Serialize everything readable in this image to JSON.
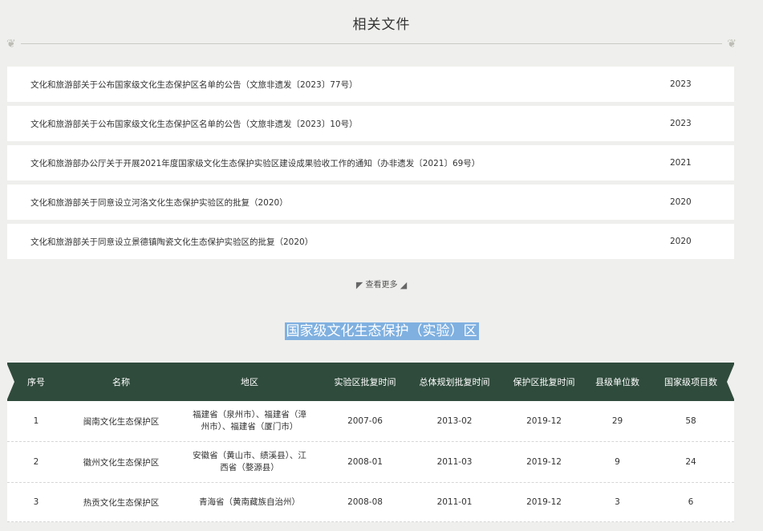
{
  "related": {
    "title": "相关文件",
    "items": [
      {
        "title": "文化和旅游部关于公布国家级文化生态保护区名单的公告（文旅非遗发〔2023〕77号）",
        "year": "2023"
      },
      {
        "title": "文化和旅游部关于公布国家级文化生态保护区名单的公告（文旅非遗发〔2023〕10号）",
        "year": "2023"
      },
      {
        "title": "文化和旅游部办公厅关于开展2021年度国家级文化生态保护实验区建设成果验收工作的通知（办非遗发〔2021〕69号）",
        "year": "2021"
      },
      {
        "title": "文化和旅游部关于同意设立河洛文化生态保护实验区的批复（2020）",
        "year": "2020"
      },
      {
        "title": "文化和旅游部关于同意设立景德镇陶瓷文化生态保护实验区的批复（2020）",
        "year": "2020"
      }
    ],
    "more_label": "查看更多"
  },
  "zones": {
    "title": "国家级文化生态保护（实验）区",
    "headers": [
      "序号",
      "名称",
      "地区",
      "实验区批复时间",
      "总体规划批复时间",
      "保护区批复时间",
      "县级单位数",
      "国家级项目数"
    ],
    "rows": [
      {
        "no": "1",
        "name": "闽南文化生态保护区",
        "region": "福建省（泉州市）、福建省（漳州市）、福建省（厦门市）",
        "exp": "2007-06",
        "plan": "2013-02",
        "zone": "2019-12",
        "counties": "29",
        "projects": "58"
      },
      {
        "no": "2",
        "name": "徽州文化生态保护区",
        "region": "安徽省（黄山市、绩溪县）、江西省（婺源县）",
        "exp": "2008-01",
        "plan": "2011-03",
        "zone": "2019-12",
        "counties": "9",
        "projects": "24"
      },
      {
        "no": "3",
        "name": "热贡文化生态保护区",
        "region": "青海省（黄南藏族自治州）",
        "exp": "2008-08",
        "plan": "2011-01",
        "zone": "2019-12",
        "counties": "3",
        "projects": "6"
      }
    ]
  },
  "icons": {
    "more_left": "arrow-icon",
    "more_right": "arrow-icon"
  }
}
